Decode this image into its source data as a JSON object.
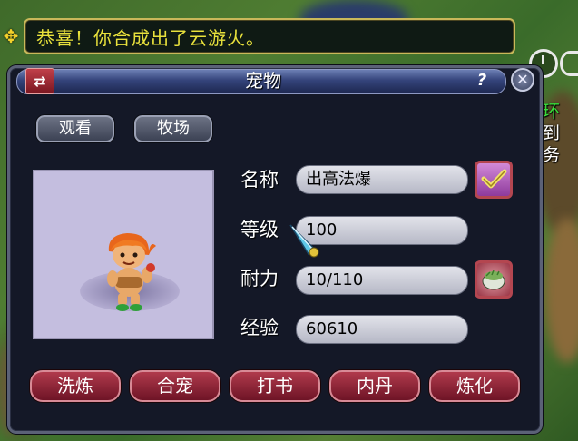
{
  "notification": {
    "message": "恭喜！你合成出了云游火。"
  },
  "side_text": [
    "环",
    "到",
    "务"
  ],
  "panel": {
    "title": "宠物",
    "help_label": "?",
    "close_label": "✕"
  },
  "tabs": {
    "view_label": "观看",
    "ranch_label": "牧场"
  },
  "fields": {
    "name_label": "名称",
    "name_value": "出高法爆",
    "level_label": "等级",
    "level_value": "100",
    "stamina_label": "耐力",
    "stamina_value": "10/110",
    "exp_label": "经验",
    "exp_value": "60610"
  },
  "actions": {
    "refine_label": "洗炼",
    "merge_label": "合宠",
    "book_label": "打书",
    "core_label": "内丹",
    "transform_label": "炼化"
  },
  "colors": {
    "notification_text": "#e8e13c",
    "panel_bg": "#141827",
    "action_button": "#8e2436",
    "side_text_green": "#39e03b"
  },
  "icons": {
    "move": "move-arrows-icon",
    "swap": "swap-arrows-icon",
    "confirm": "checkmark-icon",
    "feed": "feed-bowl-icon",
    "timer": "stopwatch-icon",
    "cursor": "sword-cursor-icon"
  }
}
